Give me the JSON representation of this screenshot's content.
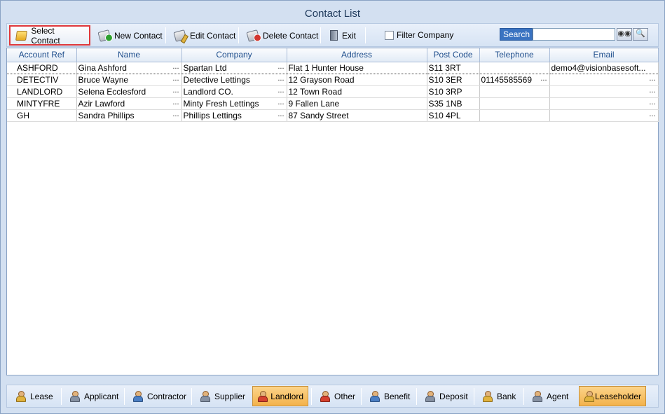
{
  "window": {
    "title": "Contact List"
  },
  "toolbar": {
    "select_label": "Select Contact",
    "new_label": "New Contact",
    "edit_label": "Edit Contact",
    "delete_label": "Delete Contact",
    "exit_label": "Exit",
    "filter_label": "Filter Company",
    "filter_checked": false,
    "search_label": "Search",
    "search_value": ""
  },
  "table": {
    "columns": [
      "Account Ref",
      "Name",
      "Company",
      "Address",
      "Post Code",
      "Telephone",
      "Email"
    ],
    "rows": [
      [
        "ASHFORD",
        "Gina Ashford",
        "Spartan Ltd",
        "Flat 1 Hunter House",
        "S11 3RT",
        "",
        "demo4@visionbasesoft..."
      ],
      [
        "DETECTIV",
        "Bruce Wayne",
        "Detective Lettings",
        "12 Grayson Road",
        "S10 3ER",
        "01145585569",
        ""
      ],
      [
        "LANDLORD",
        "Selena Ecclesford",
        "Landlord CO.",
        "12 Town Road",
        "S10 3RP",
        "",
        ""
      ],
      [
        "MINTYFRE",
        "Azir Lawford",
        "Minty Fresh Lettings",
        "9 Fallen Lane",
        "S35 1NB",
        "",
        ""
      ],
      [
        "GH",
        "Sandra Phillips",
        "Phillips Lettings",
        "87 Sandy Street",
        "S10 4PL",
        "",
        ""
      ]
    ]
  },
  "bottom": {
    "tabs": [
      {
        "label": "Lease",
        "active": false
      },
      {
        "label": "Applicant",
        "active": false
      },
      {
        "label": "Contractor",
        "active": false
      },
      {
        "label": "Supplier",
        "active": false
      },
      {
        "label": "Landlord",
        "active": true
      },
      {
        "label": "Other",
        "active": false
      },
      {
        "label": "Benefit",
        "active": false
      },
      {
        "label": "Deposit",
        "active": false
      },
      {
        "label": "Bank",
        "active": false
      },
      {
        "label": "Agent",
        "active": false
      },
      {
        "label": "Leaseholder",
        "active": true
      }
    ]
  },
  "colors": {
    "active_tab": "#f3b24b",
    "highlight_border": "#e0383b",
    "header_text": "#1e4e8c"
  }
}
